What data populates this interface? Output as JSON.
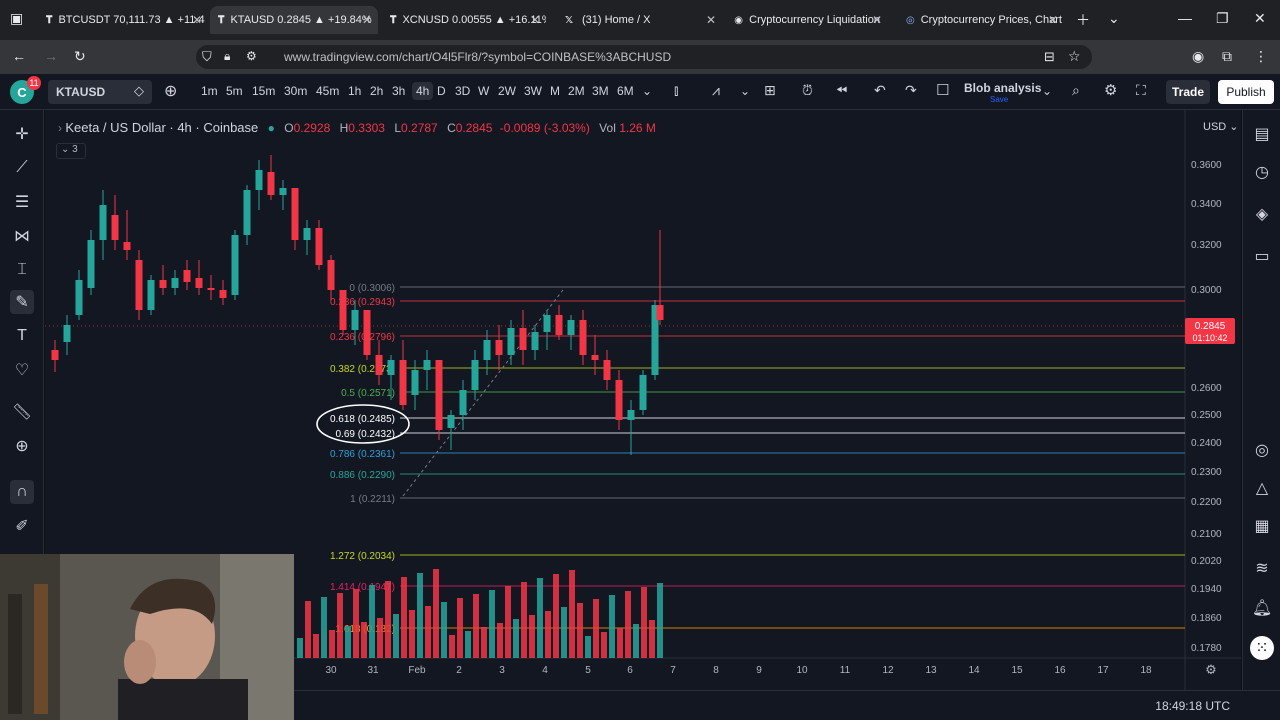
{
  "browser": {
    "tabs": [
      {
        "title": "BTCUSDT 70,111.73 ▲ +11.4",
        "icon": "tradingview-icon",
        "active": false
      },
      {
        "title": "KTAUSD 0.2845 ▲ +19.84%",
        "icon": "tradingview-icon",
        "active": true
      },
      {
        "title": "XCNUSD 0.00555 ▲ +16.11%",
        "icon": "tradingview-icon",
        "active": false
      },
      {
        "title": "(31) Home / X",
        "icon": "x-icon",
        "active": false
      },
      {
        "title": "Cryptocurrency Liquidation",
        "icon": "coinglass-icon",
        "active": false
      },
      {
        "title": "Cryptocurrency Prices, Chart",
        "icon": "coingecko-icon",
        "active": false
      }
    ],
    "url": "www.tradingview.com/chart/O4l5Flr8/?symbol=COINBASE%3ABCHUSD"
  },
  "toolbar": {
    "avatar_letter": "C",
    "notification_count": "11",
    "symbol": "KTAUSD",
    "timeframes": [
      "1m",
      "5m",
      "15m",
      "30m",
      "45m",
      "1h",
      "2h",
      "3h",
      "4h",
      "D",
      "3D",
      "W",
      "2W",
      "3W",
      "M",
      "2M",
      "3M",
      "6M"
    ],
    "active_timeframe": "4h",
    "layout_name": "Blob analysis",
    "layout_status": "Save",
    "trade_label": "Trade",
    "publish_label": "Publish"
  },
  "legend": {
    "title": "Keeta / US Dollar · 4h · Coinbase",
    "open_label": "O",
    "open": "0.2928",
    "high_label": "H",
    "high": "0.3303",
    "low_label": "L",
    "low": "0.2787",
    "close_label": "C",
    "close": "0.2845",
    "change": "-0.0089 (-3.03%)",
    "vol_label": "Vol",
    "vol": "1.26 M",
    "indicators_count": "3"
  },
  "price_axis": {
    "currency": "USD",
    "ticks": [
      "0.3600",
      "0.3400",
      "0.3200",
      "0.3000",
      "0.2600",
      "0.2500",
      "0.2400",
      "0.2300",
      "0.2200",
      "0.2100",
      "0.2020",
      "0.1940",
      "0.1860",
      "0.1780"
    ],
    "last_price": "0.2845",
    "countdown": "01:10:42"
  },
  "time_axis": {
    "ticks": [
      "30",
      "31",
      "Feb",
      "2",
      "3",
      "4",
      "5",
      "6",
      "7",
      "8",
      "9",
      "10",
      "11",
      "12",
      "13",
      "14",
      "15",
      "16",
      "17",
      "18"
    ]
  },
  "fib_levels": [
    {
      "label": "0 (0.3006)",
      "color": "#787b86"
    },
    {
      "label": "0.236 (0.2943)",
      "color": "#f23645"
    },
    {
      "label": "0.236 (0.2796)",
      "color": "#f23645"
    },
    {
      "label": "0.382 (0.2673)",
      "color": "#c8d81a"
    },
    {
      "label": "0.5 (0.2571)",
      "color": "#4caf50"
    },
    {
      "label": "0.618 (0.2485)",
      "color": "#ffffff"
    },
    {
      "label": "0.69 (0.2432)",
      "color": "#ffffff"
    },
    {
      "label": "0.786 (0.2361)",
      "color": "#2e9fd6"
    },
    {
      "label": "0.886 (0.2290)",
      "color": "#26a69a"
    },
    {
      "label": "1 (0.2211)",
      "color": "#787b86"
    },
    {
      "label": "1.272 (0.2034)",
      "color": "#c8d81a"
    },
    {
      "label": "1.414 (0.1947)",
      "color": "#e91e63"
    },
    {
      "label": "1.618 (0.182)",
      "color": "#ff9800"
    }
  ],
  "status": {
    "clock": "18:49:18 UTC"
  },
  "colors": {
    "up": "#26a69a",
    "down": "#f23645",
    "background": "#131722",
    "accent": "#2962ff"
  }
}
